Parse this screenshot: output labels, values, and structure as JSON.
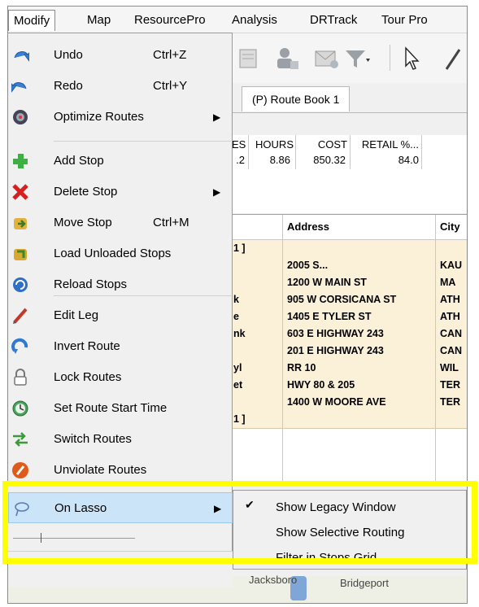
{
  "menubar": {
    "items": [
      "Modify",
      "Map",
      "ResourcePro",
      "Analysis",
      "DRTrack",
      "Tour Pro"
    ]
  },
  "tab": {
    "label": "(P) Route Book 1"
  },
  "stats": {
    "headers": [
      "ES",
      "HOURS",
      "COST",
      "RETAIL %..."
    ],
    "values": [
      ".2",
      "8.86",
      "850.32",
      "84.0"
    ]
  },
  "grid": {
    "headers": [
      "Address",
      "City"
    ],
    "rows": [
      {
        "c0": "1 ]",
        "addr": "",
        "city": ""
      },
      {
        "c0": "",
        "addr": "2005 S...",
        "city": "KAU"
      },
      {
        "c0": "",
        "addr": "1200 W MAIN ST",
        "city": "MA"
      },
      {
        "c0": "k",
        "addr": "905 W CORSICANA ST",
        "city": "ATH"
      },
      {
        "c0": "e",
        "addr": "1405 E TYLER ST",
        "city": "ATH"
      },
      {
        "c0": "nk",
        "addr": "603 E HIGHWAY 243",
        "city": "CAN"
      },
      {
        "c0": "",
        "addr": "201 E HIGHWAY 243",
        "city": "CAN"
      },
      {
        "c0": "yl",
        "addr": "RR 10",
        "city": "WIL"
      },
      {
        "c0": "et",
        "addr": "HWY 80 & 205",
        "city": "TER"
      },
      {
        "c0": "",
        "addr": "1400 W MOORE AVE",
        "city": "TER"
      },
      {
        "c0": "1 ]",
        "addr": "",
        "city": ""
      }
    ]
  },
  "map": {
    "labels": [
      "Jacksboro",
      "Bridgeport"
    ]
  },
  "menu": {
    "items": [
      {
        "label": "Undo",
        "shortcut": "Ctrl+Z",
        "icon": "undo-icon"
      },
      {
        "label": "Redo",
        "shortcut": "Ctrl+Y",
        "icon": "redo-icon"
      },
      {
        "label": "Optimize Routes",
        "submenu": true,
        "icon": "optimize-icon"
      },
      {
        "label": "Add Stop",
        "icon": "add-icon"
      },
      {
        "label": "Delete Stop",
        "submenu": true,
        "icon": "delete-icon"
      },
      {
        "label": "Move Stop",
        "shortcut": "Ctrl+M",
        "icon": "move-icon"
      },
      {
        "label": "Load Unloaded Stops",
        "icon": "load-icon"
      },
      {
        "label": "Reload Stops",
        "icon": "reload-icon"
      },
      {
        "label": "Edit Leg",
        "icon": "pencil-icon"
      },
      {
        "label": "Invert Route",
        "icon": "invert-icon"
      },
      {
        "label": "Lock Routes",
        "icon": "lock-icon"
      },
      {
        "label": "Set Route Start Time",
        "icon": "clock-icon"
      },
      {
        "label": "Switch Routes",
        "icon": "switch-icon"
      },
      {
        "label": "Unviolate Routes",
        "icon": "unviolate-icon"
      },
      {
        "label": "On Lasso",
        "submenu": true,
        "icon": "lasso-icon",
        "highlighted": true
      }
    ]
  },
  "submenu": {
    "items": [
      {
        "label": "Show Legacy Window",
        "checked": true
      },
      {
        "label": "Show Selective Routing",
        "checked": false
      },
      {
        "label": "Filter in Stops Grid",
        "checked": false
      }
    ]
  },
  "colors": {
    "highlight": "#ffff00",
    "menu_hover": "#cce4f7",
    "grid_row": "#fbf0d8"
  }
}
